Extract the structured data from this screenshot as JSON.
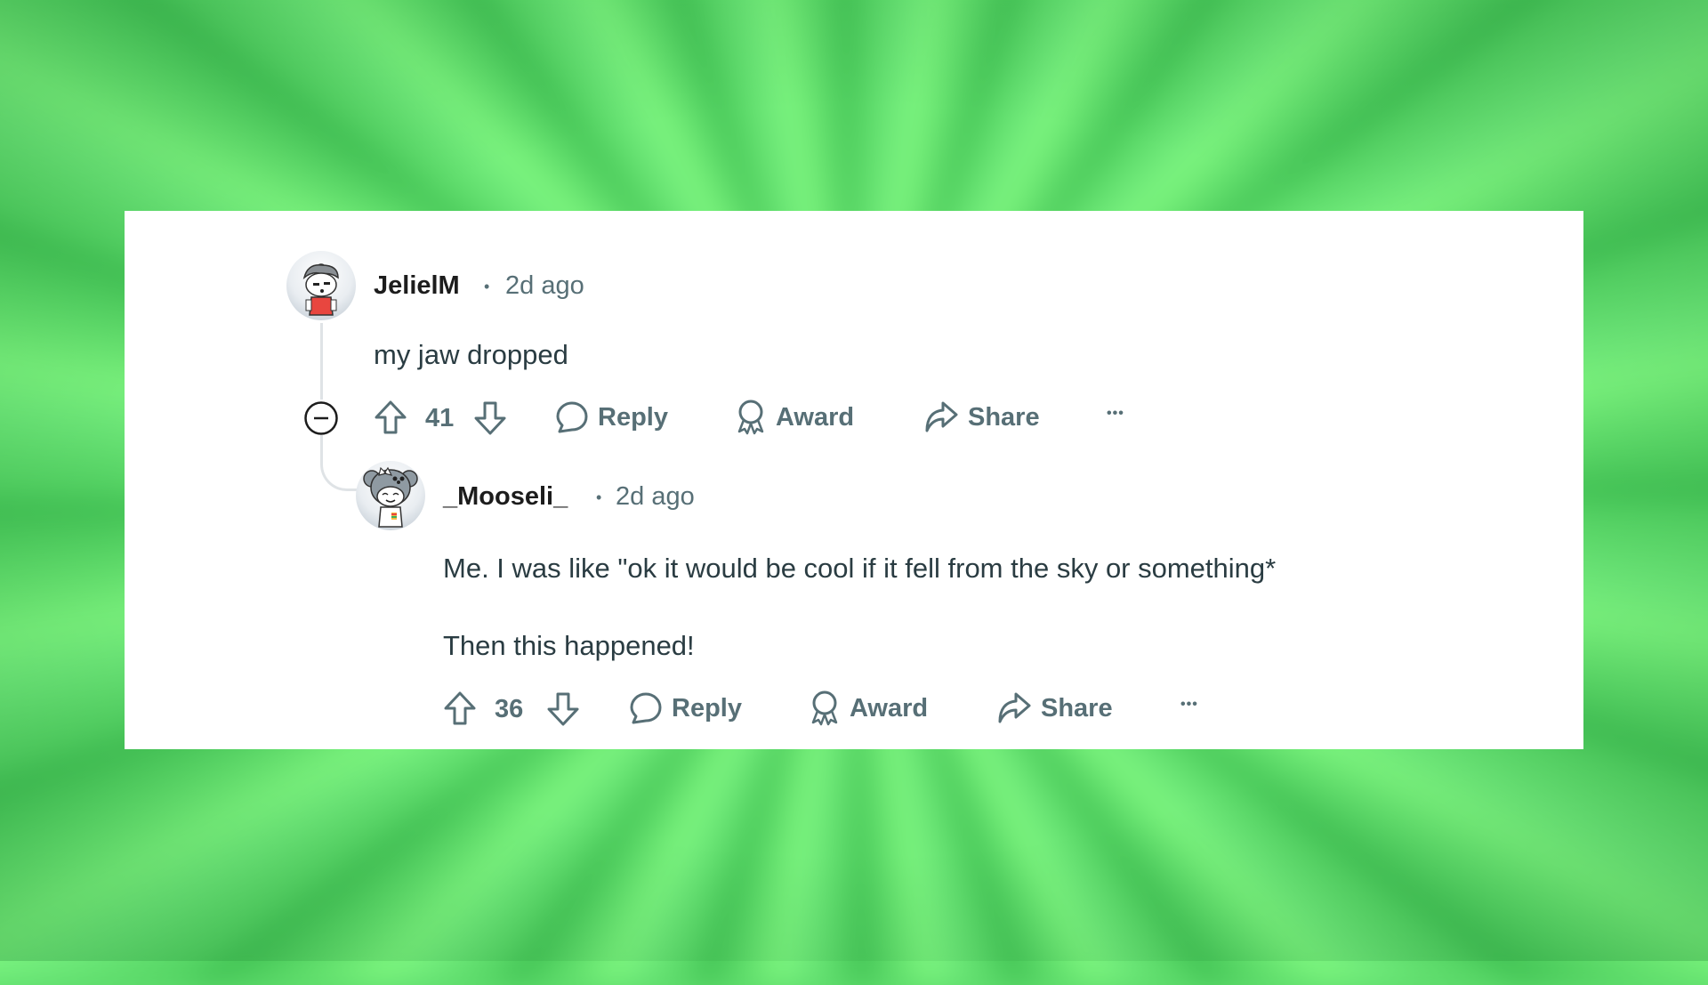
{
  "background": {
    "accent": "#5ddc6c"
  },
  "comments": [
    {
      "username": "JelielM",
      "separator": "•",
      "timestamp": "2d ago",
      "avatar": "snoo-avatar-gray-hair-red-shirt",
      "body": [
        "my jaw dropped"
      ],
      "votes": "41",
      "actions": {
        "reply": "Reply",
        "award": "Award",
        "share": "Share",
        "more": "•••"
      },
      "collapse_icon": "collapse-minus-icon"
    },
    {
      "username": "_Mooseli_",
      "separator": "•",
      "timestamp": "2d ago",
      "avatar": "snoo-avatar-koala-hood",
      "body": [
        "Me. I was like \"ok it would be cool if it fell from the sky or something*",
        "Then this happened!"
      ],
      "votes": "36",
      "actions": {
        "reply": "Reply",
        "award": "Award",
        "share": "Share",
        "more": "•••"
      }
    }
  ],
  "colors": {
    "username": "#1c1c1c",
    "meta": "#576f76",
    "body": "#2a3c42",
    "thread_line": "#dfe3e6"
  }
}
